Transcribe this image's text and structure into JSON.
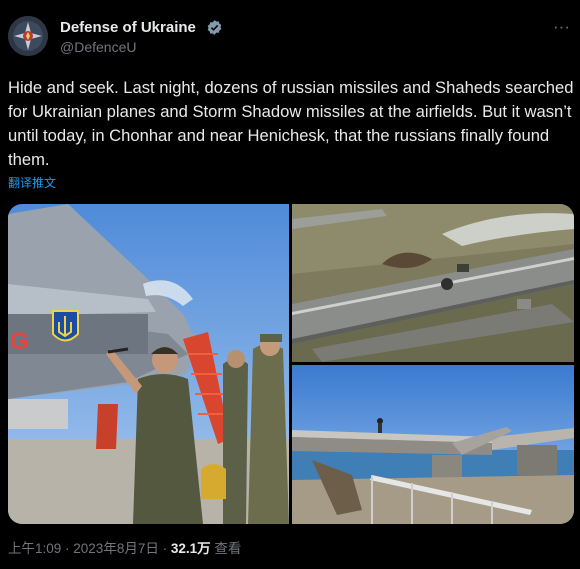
{
  "account": {
    "display_name": "Defense of Ukraine",
    "handle": "@DefenceU",
    "verified_icon": "verified-badge-icon",
    "avatar_icon": "ministry-emblem-icon"
  },
  "more_label": "···",
  "tweet": {
    "text": "Hide and seek. Last night, dozens of russian missiles and Shaheds searched for Ukrainian planes and Storm Shadow missiles at the airfields. But it wasn’t until today, in Chonhar and near Henichesk, that the russians finally found them.",
    "translate_label": "翻译推文"
  },
  "media": [
    {
      "name": "photo-jet-signing",
      "letter": "G"
    },
    {
      "name": "photo-damaged-bridge-aerial"
    },
    {
      "name": "photo-collapsed-bridge"
    }
  ],
  "meta": {
    "time": "上午1:09",
    "sep1": " · ",
    "date": "2023年8月7日",
    "sep2": " · ",
    "views_count": "32.1万",
    "views_label": " 查看"
  },
  "colors": {
    "link": "#1d9bf0",
    "secondary_text": "#71767b",
    "verified": "#829aab"
  }
}
